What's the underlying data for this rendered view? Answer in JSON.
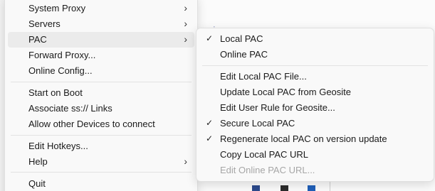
{
  "main_menu": {
    "items": [
      {
        "label": "System Proxy",
        "submenu": true
      },
      {
        "label": "Servers",
        "submenu": true
      },
      {
        "label": "PAC",
        "submenu": true,
        "active": true
      },
      {
        "label": "Forward Proxy..."
      },
      {
        "label": "Online Config..."
      },
      {
        "label": "Start on Boot"
      },
      {
        "label": "Associate ss:// Links"
      },
      {
        "label": "Allow other Devices to connect"
      },
      {
        "label": "Edit Hotkeys..."
      },
      {
        "label": "Help",
        "submenu": true
      },
      {
        "label": "Quit"
      }
    ],
    "chevron": "›"
  },
  "pac_submenu": {
    "items": [
      {
        "label": "Local PAC",
        "checked": true
      },
      {
        "label": "Online PAC",
        "checked": false
      },
      {
        "label": "Edit Local PAC File...",
        "checked": false
      },
      {
        "label": "Update Local PAC from Geosite",
        "checked": false
      },
      {
        "label": "Edit User Rule for Geosite...",
        "checked": false
      },
      {
        "label": "Secure Local PAC",
        "checked": true
      },
      {
        "label": "Regenerate local PAC on version update",
        "checked": true
      },
      {
        "label": "Copy Local PAC URL",
        "checked": false
      },
      {
        "label": "Edit Online PAC URL...",
        "checked": false,
        "disabled": true
      }
    ],
    "check_glyph": "✓"
  },
  "background": {
    "fragment_text": "-.:.-,,,-."
  },
  "colors": {
    "menu_bg": "#f9f9f9",
    "highlight": "#ebebeb",
    "disabled_text": "#a6a6a6"
  }
}
